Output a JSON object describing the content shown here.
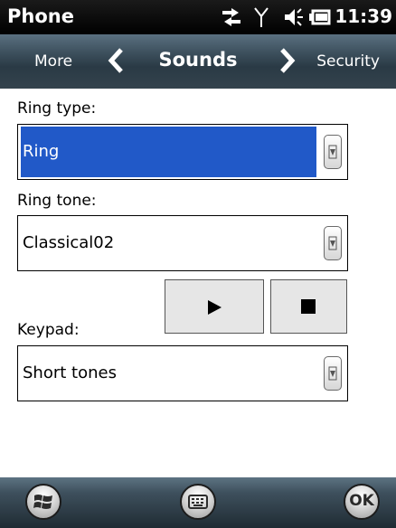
{
  "status_bar": {
    "title": "Phone",
    "time": "11:39"
  },
  "nav": {
    "prev_label": "More",
    "title": "Sounds",
    "next_label": "Security"
  },
  "form": {
    "ring_type": {
      "label": "Ring type:",
      "value": "Ring"
    },
    "ring_tone": {
      "label": "Ring tone:",
      "value": "Classical02"
    },
    "keypad": {
      "label": "Keypad:",
      "value": "Short tones"
    }
  },
  "bottom_bar": {
    "ok_label": "OK"
  },
  "colors": {
    "selection": "#2159c8"
  }
}
